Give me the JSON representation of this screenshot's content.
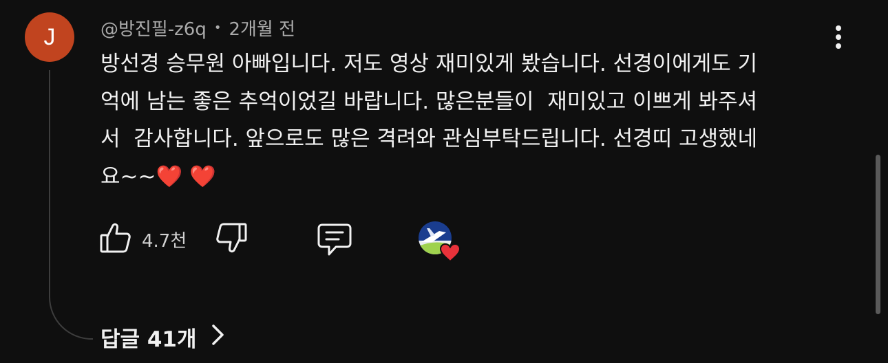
{
  "comment": {
    "avatar_letter": "J",
    "author": "@방진필-z6q",
    "separator": "•",
    "time": "2개월 전",
    "lines": [
      "방선경 승무원 아빠입니다. 저도 영상 재미있게 봤습니다. 선경이에게도 기",
      "억에 남는 좋은 추억이었길 바랍니다. 많은분들이  재미있고 이쁘게 봐주셔",
      "서  감사합니다. 앞으로도 많은 격려와 관심부탁드립니다. 선경띠 고생했네"
    ],
    "last_line_text": "요~~",
    "emoji": [
      "❤️",
      "❤️"
    ]
  },
  "actions": {
    "like_icon": "thumbs-up-icon",
    "like_count": "4.7천",
    "dislike_icon": "thumbs-down-icon",
    "reply_icon": "comment-icon",
    "creator_heart_icon": "creator-heart-icon"
  },
  "replies": {
    "label": "답글 41개",
    "chevron_icon": "chevron-right-icon"
  },
  "colors": {
    "background": "#0f0f0f",
    "avatar": "#c1441f",
    "text": "#f1f1f1",
    "meta": "#aaaaaa",
    "heart": "#e8323a"
  }
}
